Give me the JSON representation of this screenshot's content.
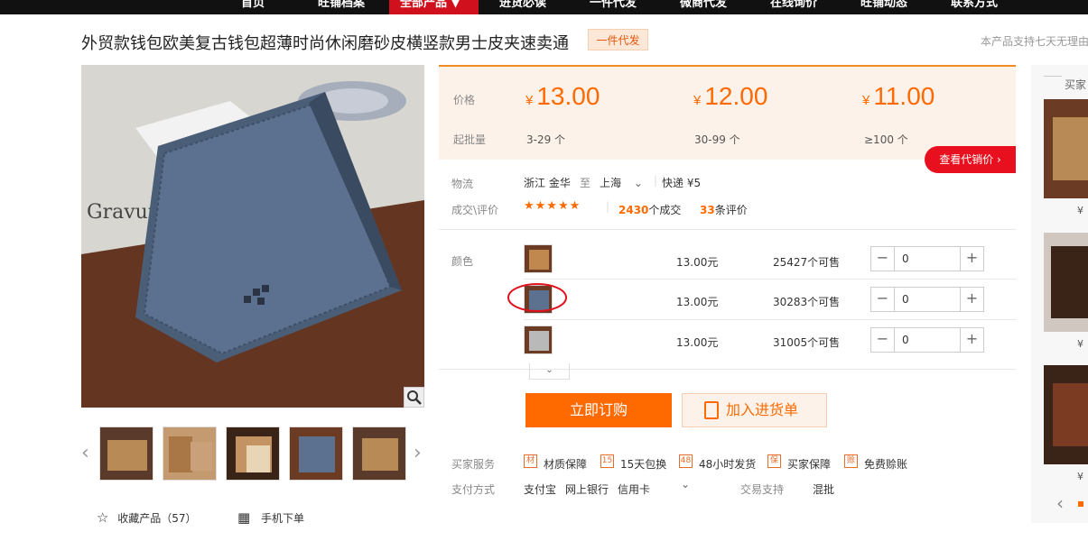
{
  "nav": {
    "items": [
      "首页",
      "旺铺档案",
      "全部产品 ▼",
      "进货必读",
      "一件代发",
      "微商代发",
      "在线询价",
      "旺铺动态",
      "联系方式"
    ],
    "active_index": 2,
    "active_color": "#d0101c"
  },
  "product": {
    "title": "外贸款钱包欧美复古钱包超薄时尚休闲磨砂皮横竖款男士皮夹速卖通",
    "badge": "一件代发",
    "support_text": "本产品支持七天无理由"
  },
  "pricing": {
    "price_label": "价格",
    "batch_label": "起批量",
    "currency": "¥",
    "tiers": [
      {
        "price": "13.00",
        "qty": "3-29 个"
      },
      {
        "price": "12.00",
        "qty": "30-99 个"
      },
      {
        "price": "11.00",
        "qty": "≥100 个"
      }
    ],
    "accent_color": "#ff6a00"
  },
  "view_agent_price": {
    "label": "查看代销价 ›"
  },
  "logistics": {
    "label": "物流",
    "from": "浙江 金华",
    "to_label": "至",
    "to": "上海",
    "shipping": "快递 ¥5"
  },
  "deals": {
    "label": "成交\\评价",
    "stars": "★★★★★",
    "rating": 4.5,
    "deal_count": "2430",
    "deal_suffix": "个成交",
    "review_count": "33",
    "review_suffix": "条评价"
  },
  "color": {
    "label": "颜色",
    "options": [
      {
        "price": "13.00元",
        "stock": "25427个可售",
        "quantity": "0"
      },
      {
        "price": "13.00元",
        "stock": "30283个可售",
        "quantity": "0"
      },
      {
        "price": "13.00元",
        "stock": "31005个可售",
        "quantity": "0"
      }
    ]
  },
  "actions": {
    "buy_now": "立即订购",
    "add_cart": "加入进货单"
  },
  "services": {
    "label": "买家服务",
    "items": [
      {
        "icon": "材",
        "text": "材质保障"
      },
      {
        "icon": "15",
        "text": "15天包换"
      },
      {
        "icon": "48",
        "text": "48小时发货"
      },
      {
        "icon": "保",
        "text": "买家保障"
      },
      {
        "icon": "赊",
        "text": "免费赊账"
      }
    ]
  },
  "payment": {
    "label": "支付方式",
    "methods": [
      "支付宝",
      "网上银行",
      "信用卡"
    ],
    "trade_label": "交易支持",
    "trade_value": "混批"
  },
  "favorites": {
    "label": "收藏产品（57）"
  },
  "mobile": {
    "label": "手机下单"
  },
  "sidebar": {
    "title": "买家",
    "prices": [
      "¥",
      "¥",
      "¥"
    ]
  }
}
